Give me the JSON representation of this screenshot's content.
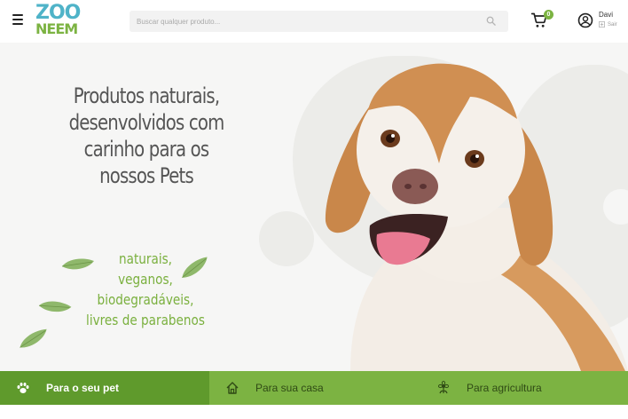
{
  "header": {
    "logo_line1": "ZOO",
    "logo_line2": "NEEM",
    "search_placeholder": "Buscar qualquer produto...",
    "cart_count": "0",
    "user_name": "Davi",
    "logout_label": "Sair"
  },
  "hero": {
    "headline": [
      "Produtos naturais,",
      "desenvolvidos com",
      "carinho para os",
      "nossos Pets"
    ],
    "features": [
      "naturais,",
      "veganos,",
      "biodegradáveis,",
      "livres de parabenos"
    ]
  },
  "categories": [
    {
      "label": "Para o seu pet",
      "icon": "paw-icon"
    },
    {
      "label": "Para sua casa",
      "icon": "home-icon"
    },
    {
      "label": "Para agricultura",
      "icon": "plant-icon"
    }
  ],
  "colors": {
    "brand_green": "#7cb342",
    "brand_dark_green": "#5f9a2c",
    "brand_blue": "#4fb3c8",
    "headline_gray": "#555555"
  }
}
